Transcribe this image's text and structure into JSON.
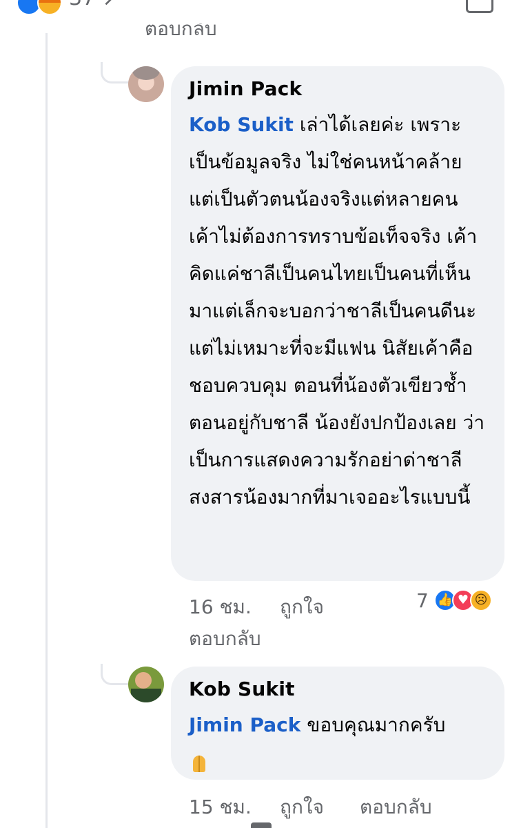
{
  "top": {
    "reaction_count": "37",
    "cut_reply_label": "ตอบกลับ"
  },
  "comments": [
    {
      "author": "Jimin Pack",
      "mention": "Kob Sukit",
      "text_after_mention": " เล่าได้เลยค่ะ เพราะเป็นข้อมูลจริง ไม่ใช่คนหน้าคล้ายแต่เป็นตัวตนน้องจริงแต่หลายคนเค้าไม่ต้องการทราบข้อเท็จจริง เค้าคิดแค่ชาลีเป็นคนไทยเป็นคนที่เห็นมาแต่เล็กจะบอกว่าชาลีเป็นคนดีนะ แต่ไม่เหมาะที่จะมีแฟน นิสัยเค้าคือชอบควบคุม ตอนที่น้องตัวเขียวช้ำตอนอยู่กับชาลี น้องยังปกป้องเลย ว่าเป็นการแสดงความรักอย่าด่าชาลี สงสารน้องมากที่มาเจออะไรแบบนี้",
      "time": "16 ชม.",
      "like_label": "ถูกใจ",
      "reply_label": "ตอบกลับ",
      "reaction_count": "7",
      "reactions": [
        "like-icon",
        "love-icon",
        "sad-icon"
      ]
    },
    {
      "author": "Kob Sukit",
      "mention": "Jimin Pack",
      "text_after_mention": " ขอบคุณมากครับ",
      "emoji": "folded-hands",
      "time": "15 ชม.",
      "like_label": "ถูกใจ",
      "reply_label": "ตอบกลับ"
    }
  ]
}
